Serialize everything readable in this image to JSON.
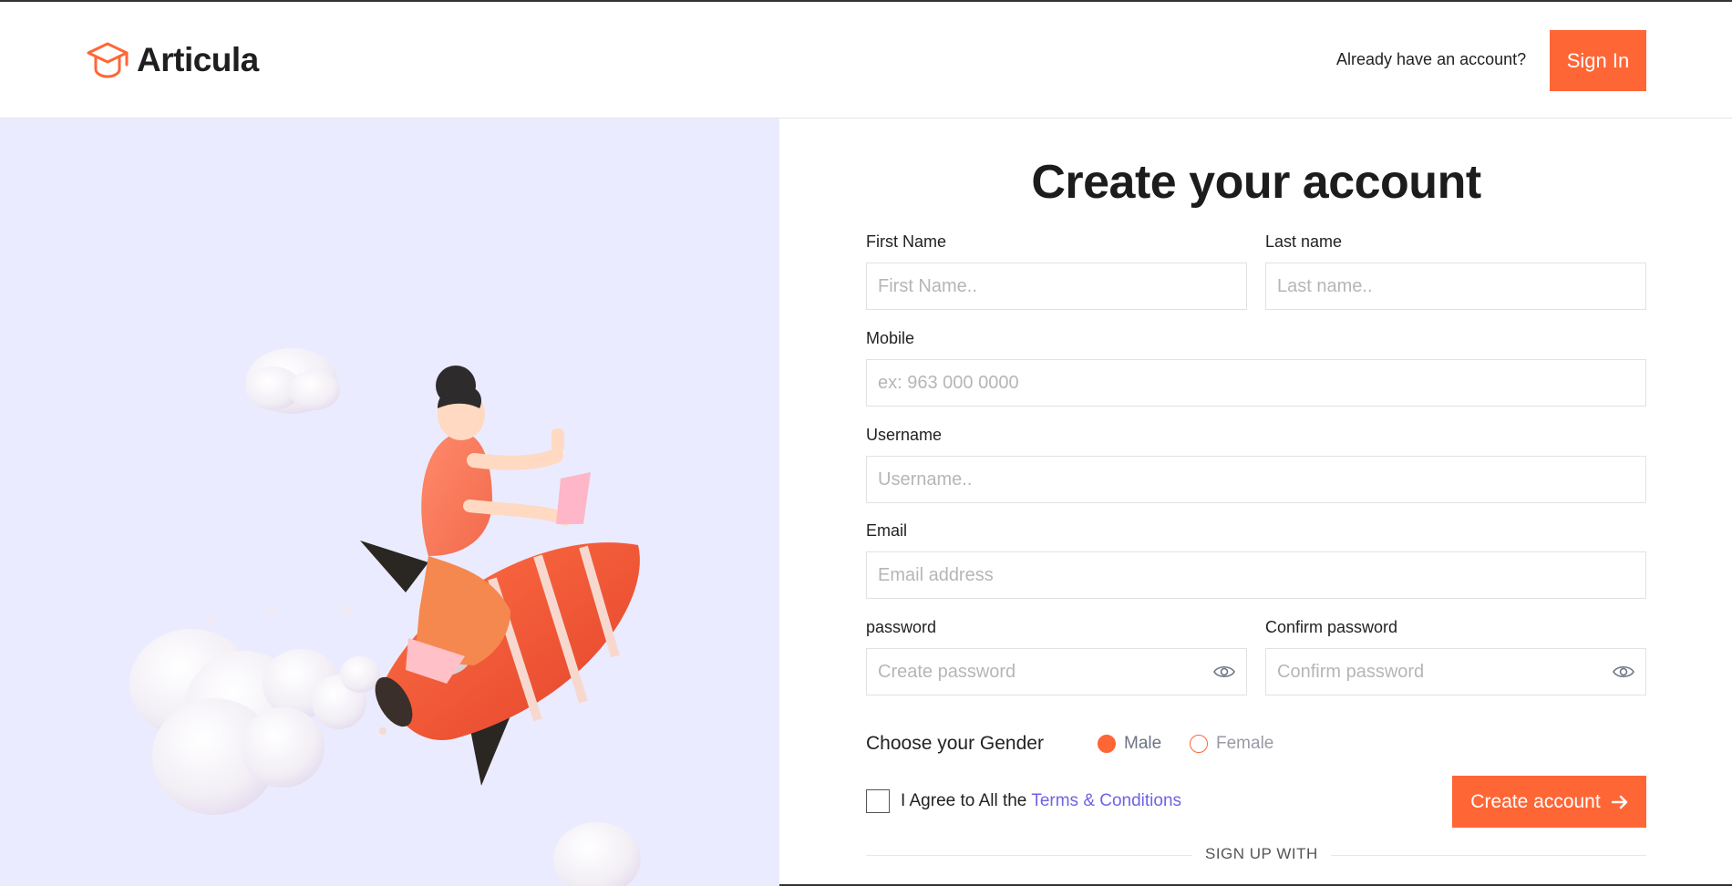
{
  "header": {
    "brand": "Articula",
    "have_account": "Already have an account?",
    "signin_label": "Sign In"
  },
  "form": {
    "title": "Create your account",
    "first_name": {
      "label": "First Name",
      "placeholder": "First Name.."
    },
    "last_name": {
      "label": "Last name",
      "placeholder": "Last name.."
    },
    "mobile": {
      "label": "Mobile",
      "placeholder": "ex: 963 000 0000"
    },
    "username": {
      "label": "Username",
      "placeholder": "Username.."
    },
    "email": {
      "label": "Email",
      "placeholder": "Email address"
    },
    "password": {
      "label": "password",
      "placeholder": "Create password"
    },
    "confirm_password": {
      "label": "Confirm password",
      "placeholder": "Confirm password"
    },
    "gender": {
      "label": "Choose your Gender",
      "options": [
        "Male",
        "Female"
      ],
      "selected": "Male"
    },
    "agree_text": "I Agree to All the",
    "terms_link": "Terms & Conditions",
    "submit_label": "Create account",
    "signup_with": "SIGN UP WITH"
  },
  "colors": {
    "accent": "#ff6636",
    "panel_bg": "#ebebff",
    "link": "#6f63e6"
  },
  "icons": {
    "brand": "graduation-cap-icon",
    "password_toggle": "eye-icon",
    "submit_arrow": "arrow-right-icon"
  }
}
